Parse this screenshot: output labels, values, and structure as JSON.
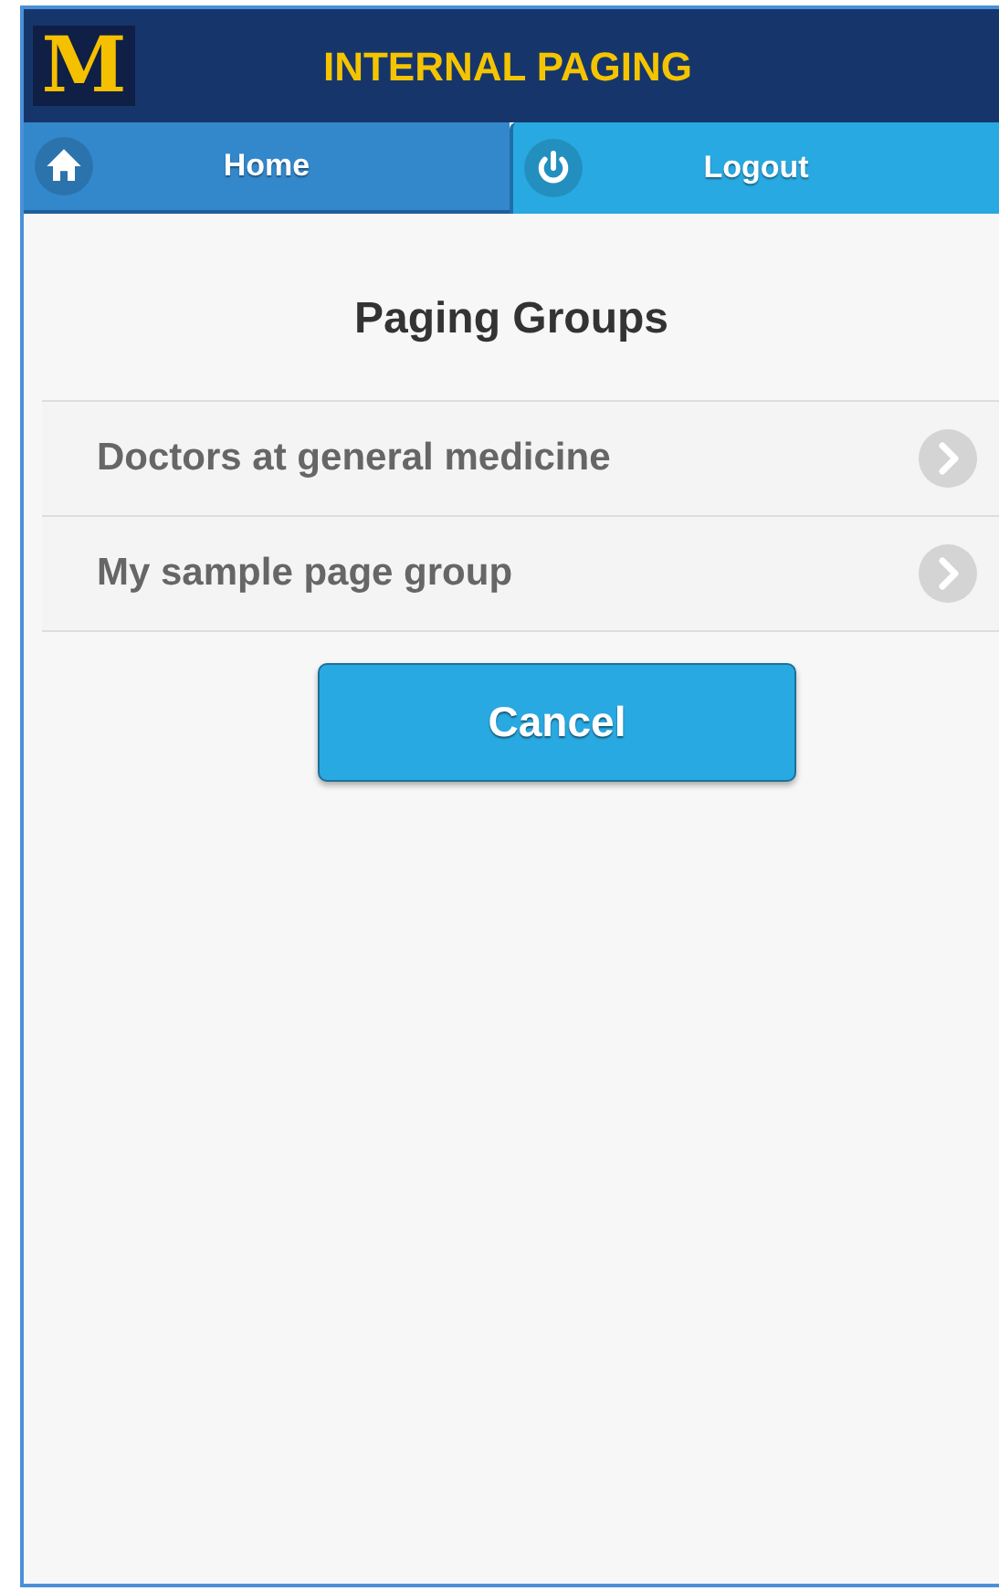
{
  "header": {
    "logo": "M",
    "title": "INTERNAL PAGING"
  },
  "tabs": [
    {
      "label": "Home",
      "kind": "home",
      "selected": true
    },
    {
      "label": "Logout",
      "kind": "power",
      "selected": false
    }
  ],
  "heading": "Paging Groups",
  "groups": [
    {
      "label": "Doctors at general medicine"
    },
    {
      "label": "My sample page group"
    }
  ],
  "cancel_button": "Cancel"
}
